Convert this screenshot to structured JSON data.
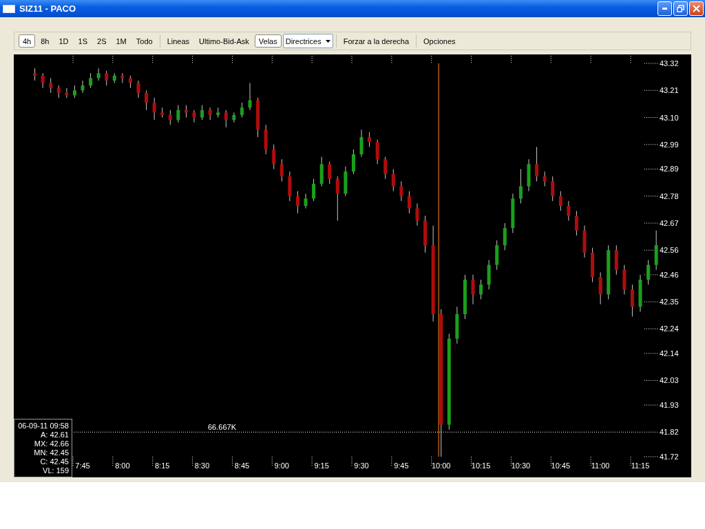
{
  "window": {
    "title": "SIZ11 - PACO"
  },
  "toolbar": {
    "groups": [
      [
        {
          "label": "4h",
          "kind": "button",
          "selected": true
        },
        {
          "label": "8h",
          "kind": "button",
          "selected": false
        },
        {
          "label": "1D",
          "kind": "button",
          "selected": false
        },
        {
          "label": "1S",
          "kind": "button",
          "selected": false
        },
        {
          "label": "2S",
          "kind": "button",
          "selected": false
        },
        {
          "label": "1M",
          "kind": "button",
          "selected": false
        },
        {
          "label": "Todo",
          "kind": "button",
          "selected": false
        }
      ],
      [
        {
          "label": "Lineas",
          "kind": "button",
          "selected": false
        },
        {
          "label": "Ultimo-Bid-Ask",
          "kind": "button",
          "selected": false
        },
        {
          "label": "Velas",
          "kind": "button",
          "selected": true
        },
        {
          "label": "Directrices",
          "kind": "dropdown",
          "selected": false
        }
      ],
      [
        {
          "label": "Forzar a la derecha",
          "kind": "button",
          "selected": false
        }
      ],
      [
        {
          "label": "Opciones",
          "kind": "button",
          "selected": false
        }
      ]
    ]
  },
  "chart": {
    "info": [
      "06-09-11 09:58",
      "A: 42.61",
      "MX: 42.66",
      "MN: 42.45",
      "C: 42.45",
      "VL: 159"
    ],
    "chart_data": {
      "type": "candlestick",
      "ylim": [
        41.72,
        43.32
      ],
      "ref_lines": [
        {
          "axis": "y",
          "value": 41.82,
          "label": "66.667K"
        }
      ],
      "yticks": [
        {
          "value": 43.32,
          "label": "43.32"
        },
        {
          "value": 43.21,
          "label": "43.21"
        },
        {
          "value": 43.1,
          "label": "43.10"
        },
        {
          "value": 42.99,
          "label": "42.99"
        },
        {
          "value": 42.89,
          "label": "42.89"
        },
        {
          "value": 42.78,
          "label": "42.78"
        },
        {
          "value": 42.67,
          "label": "42.67"
        },
        {
          "value": 42.56,
          "label": "42.56"
        },
        {
          "value": 42.46,
          "label": "42.46"
        },
        {
          "value": 42.35,
          "label": "42.35"
        },
        {
          "value": 42.24,
          "label": "42.24"
        },
        {
          "value": 42.14,
          "label": "42.14"
        },
        {
          "value": 42.03,
          "label": "42.03"
        },
        {
          "value": 41.93,
          "label": "41.93"
        },
        {
          "value": 41.82,
          "label": "41.82"
        },
        {
          "value": 41.72,
          "label": "41.72"
        }
      ],
      "categories": [
        null,
        null,
        null,
        null,
        null,
        null,
        "7:45",
        null,
        null,
        null,
        null,
        "8:00",
        null,
        null,
        null,
        null,
        "8:15",
        null,
        null,
        null,
        null,
        "8:30",
        null,
        null,
        null,
        null,
        "8:45",
        null,
        null,
        null,
        null,
        "9:00",
        null,
        null,
        null,
        null,
        "9:15",
        null,
        null,
        null,
        null,
        "9:30",
        null,
        null,
        null,
        null,
        "9:45",
        null,
        null,
        null,
        null,
        "10:00",
        null,
        null,
        null,
        null,
        "10:15",
        null,
        null,
        null,
        null,
        "10:30",
        null,
        null,
        null,
        null,
        "10:45",
        null,
        null,
        null,
        null,
        "11:00",
        null,
        null,
        null,
        null,
        "11:15",
        null,
        null
      ],
      "ohlc": [
        [
          43.28,
          43.3,
          43.25,
          43.27
        ],
        [
          43.27,
          43.28,
          43.22,
          43.24
        ],
        [
          43.24,
          43.26,
          43.2,
          43.22
        ],
        [
          43.22,
          43.23,
          43.18,
          43.2
        ],
        [
          43.2,
          43.22,
          43.18,
          43.19
        ],
        [
          43.19,
          43.23,
          43.18,
          43.21
        ],
        [
          43.21,
          43.25,
          43.2,
          43.23
        ],
        [
          43.23,
          43.28,
          43.22,
          43.26
        ],
        [
          43.26,
          43.3,
          43.25,
          43.28
        ],
        [
          43.28,
          43.29,
          43.23,
          43.25
        ],
        [
          43.25,
          43.28,
          43.24,
          43.27
        ],
        [
          43.27,
          43.28,
          43.24,
          43.26
        ],
        [
          43.26,
          43.27,
          43.22,
          43.24
        ],
        [
          43.24,
          43.25,
          43.18,
          43.2
        ],
        [
          43.2,
          43.21,
          43.13,
          43.16
        ],
        [
          43.16,
          43.18,
          43.09,
          43.12
        ],
        [
          43.12,
          43.14,
          43.1,
          43.11
        ],
        [
          43.11,
          43.13,
          43.07,
          43.09
        ],
        [
          43.09,
          43.15,
          43.08,
          43.13
        ],
        [
          43.13,
          43.15,
          43.1,
          43.12
        ],
        [
          43.12,
          43.13,
          43.08,
          43.1
        ],
        [
          43.1,
          43.15,
          43.09,
          43.13
        ],
        [
          43.13,
          43.14,
          43.09,
          43.11
        ],
        [
          43.11,
          43.14,
          43.1,
          43.12
        ],
        [
          43.12,
          43.13,
          43.06,
          43.09
        ],
        [
          43.09,
          43.12,
          43.08,
          43.11
        ],
        [
          43.11,
          43.16,
          43.1,
          43.14
        ],
        [
          43.14,
          43.24,
          43.13,
          43.17
        ],
        [
          43.17,
          43.18,
          43.02,
          43.05
        ],
        [
          43.05,
          43.07,
          42.95,
          42.97
        ],
        [
          42.97,
          42.99,
          42.89,
          42.91
        ],
        [
          42.91,
          42.93,
          42.84,
          42.86
        ],
        [
          42.86,
          42.88,
          42.76,
          42.78
        ],
        [
          42.78,
          42.8,
          42.71,
          42.74
        ],
        [
          42.74,
          42.79,
          42.73,
          42.77
        ],
        [
          42.77,
          42.85,
          42.76,
          42.83
        ],
        [
          42.83,
          42.94,
          42.82,
          42.91
        ],
        [
          42.91,
          42.92,
          42.83,
          42.85
        ],
        [
          42.85,
          42.86,
          42.68,
          42.79
        ],
        [
          42.79,
          42.9,
          42.78,
          42.88
        ],
        [
          42.88,
          42.97,
          42.87,
          42.95
        ],
        [
          42.95,
          43.05,
          42.94,
          43.02
        ],
        [
          43.02,
          43.04,
          42.98,
          43.0
        ],
        [
          43.0,
          43.01,
          42.91,
          42.93
        ],
        [
          42.93,
          42.94,
          42.85,
          42.87
        ],
        [
          42.87,
          42.89,
          42.8,
          42.82
        ],
        [
          42.82,
          42.84,
          42.76,
          42.78
        ],
        [
          42.78,
          42.8,
          42.71,
          42.73
        ],
        [
          42.73,
          42.75,
          42.66,
          42.68
        ],
        [
          42.68,
          42.7,
          42.55,
          42.58
        ],
        [
          42.58,
          42.66,
          42.27,
          42.3
        ],
        [
          42.3,
          42.32,
          41.72,
          41.85
        ],
        [
          41.85,
          42.22,
          41.83,
          42.2
        ],
        [
          42.2,
          42.33,
          42.18,
          42.3
        ],
        [
          42.3,
          42.46,
          42.28,
          42.44
        ],
        [
          42.44,
          42.46,
          42.34,
          42.38
        ],
        [
          42.38,
          42.44,
          42.36,
          42.42
        ],
        [
          42.42,
          42.52,
          42.4,
          42.5
        ],
        [
          42.5,
          42.6,
          42.48,
          42.58
        ],
        [
          42.58,
          42.67,
          42.56,
          42.65
        ],
        [
          42.65,
          42.79,
          42.63,
          42.77
        ],
        [
          42.77,
          42.89,
          42.75,
          42.82
        ],
        [
          42.82,
          42.93,
          42.8,
          42.91
        ],
        [
          42.91,
          42.98,
          42.84,
          42.86
        ],
        [
          42.86,
          42.88,
          42.82,
          42.84
        ],
        [
          42.84,
          42.86,
          42.76,
          42.78
        ],
        [
          42.78,
          42.8,
          42.72,
          42.74
        ],
        [
          42.74,
          42.76,
          42.68,
          42.7
        ],
        [
          42.7,
          42.72,
          42.62,
          42.64
        ],
        [
          42.64,
          42.66,
          42.53,
          42.55
        ],
        [
          42.55,
          42.57,
          42.43,
          42.45
        ],
        [
          42.45,
          42.47,
          42.34,
          42.38
        ],
        [
          42.38,
          42.58,
          42.36,
          42.56
        ],
        [
          42.56,
          42.58,
          42.46,
          42.48
        ],
        [
          42.48,
          42.5,
          42.38,
          42.4
        ],
        [
          42.4,
          42.42,
          42.29,
          42.33
        ],
        [
          42.33,
          42.46,
          42.31,
          42.44
        ],
        [
          42.44,
          42.52,
          42.42,
          42.5
        ],
        [
          42.5,
          42.64,
          42.48,
          42.58
        ]
      ]
    }
  }
}
